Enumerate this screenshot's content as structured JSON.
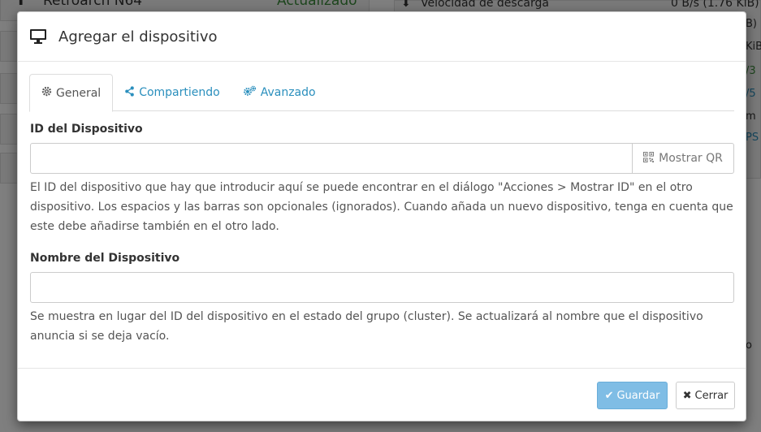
{
  "background": {
    "left_title": "Retroarch N64",
    "left_status": "Actualizado",
    "right_label": "Velocidad de descarga",
    "right_value": "0 B/s (1.76 KiB)",
    "right_fragments": [
      "B)",
      "KiB",
      "/3",
      "/5",
      "m",
      "PS",
      "o"
    ]
  },
  "modal": {
    "title": "Agregar el dispositivo",
    "tabs": [
      {
        "label": "General",
        "icon": "gear-icon"
      },
      {
        "label": "Compartiendo",
        "icon": "share-icon"
      },
      {
        "label": "Avanzado",
        "icon": "gears-icon"
      }
    ],
    "device_id": {
      "label": "ID del Dispositivo",
      "value": "",
      "placeholder": "",
      "qr_button": "Mostrar QR",
      "help": "El ID del dispositivo que hay que introducir aquí se puede encontrar en el diálogo \"Acciones > Mostrar ID\" en el otro dispositivo. Los espacios y las barras son opcionales (ignorados). Cuando añada un nuevo dispositivo, tenga en cuenta que este debe añadirse también en el otro lado."
    },
    "device_name": {
      "label": "Nombre del Dispositivo",
      "value": "",
      "placeholder": "",
      "help": "Se muestra en lugar del ID del dispositivo en el estado del grupo (cluster). Se actualizará al nombre que el dispositivo anuncia si se deja vacío."
    },
    "footer": {
      "save_label": "Guardar",
      "close_label": "Cerrar"
    }
  },
  "colors": {
    "link": "#2a8fbd",
    "primary": "#7fbde5"
  }
}
